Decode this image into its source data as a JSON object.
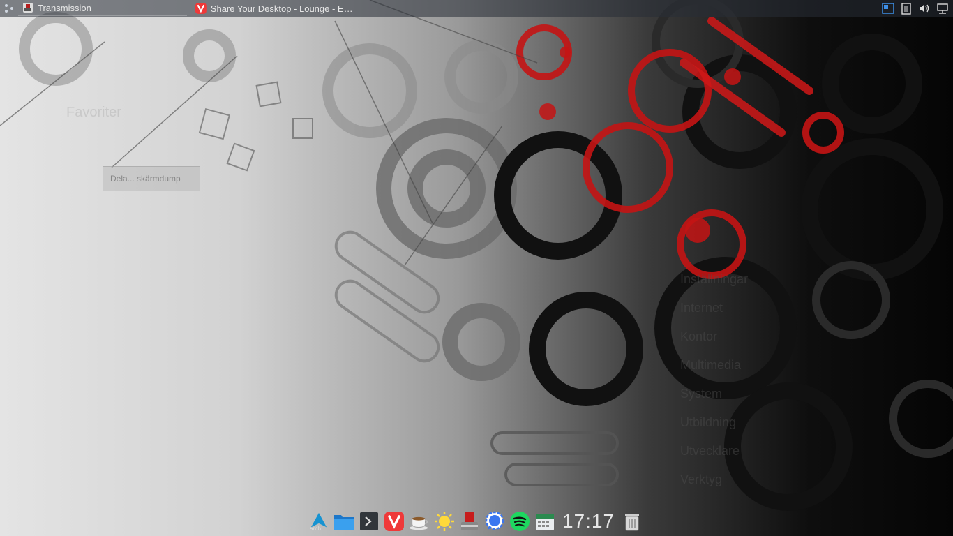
{
  "top_panel": {
    "tasks": [
      {
        "label": "Transmission",
        "icon": "transmission-icon"
      },
      {
        "label": "Share Your Desktop - Lounge - En...",
        "icon": "vivaldi-icon"
      }
    ],
    "tray_icons": [
      "pager-icon",
      "clipboard-icon",
      "volume-icon",
      "network-icon"
    ]
  },
  "ghost_overlay": {
    "favorites_heading": "Favoriter",
    "tooltip": "Dela... skärmdump",
    "menu_items": [
      "Inställningar",
      "Internet",
      "Kontor",
      "Multimedia",
      "System",
      "Utbildning",
      "Utvecklare",
      "Verktyg"
    ]
  },
  "dock": {
    "items": [
      "arch-launcher-icon",
      "file-manager-icon",
      "terminal-icon",
      "vivaldi-icon",
      "coffee-icon",
      "weather-icon",
      "transmission-icon",
      "signal-icon",
      "spotify-icon",
      "calendar-icon"
    ],
    "clock": "17:17",
    "trash_icon": "trash-icon",
    "launcher_label": "arch"
  },
  "colors": {
    "accent_red": "#d01818",
    "panel_bg": "#282d37"
  }
}
